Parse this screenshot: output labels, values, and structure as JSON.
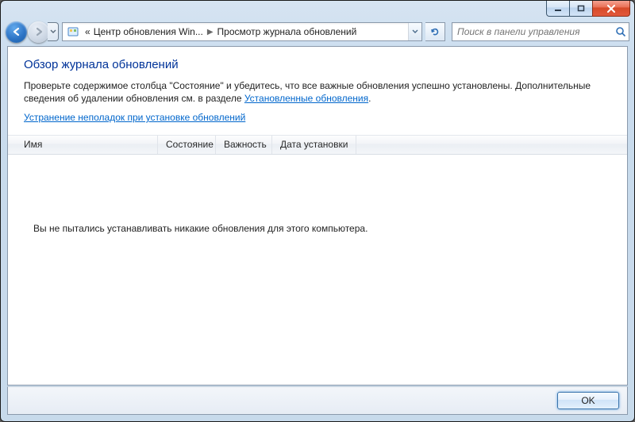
{
  "nav": {
    "breadcrumb_prefix": "«",
    "crumb1": "Центр обновления Win...",
    "crumb2": "Просмотр журнала обновлений"
  },
  "search": {
    "placeholder": "Поиск в панели управления"
  },
  "page": {
    "title": "Обзор журнала обновлений",
    "intro_part1": "Проверьте содержимое столбца \"Состояние\" и убедитесь, что все важные обновления успешно установлены. Дополнительные сведения об удалении обновления см. в разделе ",
    "intro_link": "Установленные обновления",
    "intro_end": ".",
    "troubleshoot_link": "Устранение неполадок при установке обновлений"
  },
  "columns": {
    "name": "Имя",
    "state": "Состояние",
    "severity": "Важность",
    "date": "Дата установки"
  },
  "empty_message": "Вы не пытались устанавливать никакие обновления для этого компьютера.",
  "buttons": {
    "ok": "OK"
  }
}
